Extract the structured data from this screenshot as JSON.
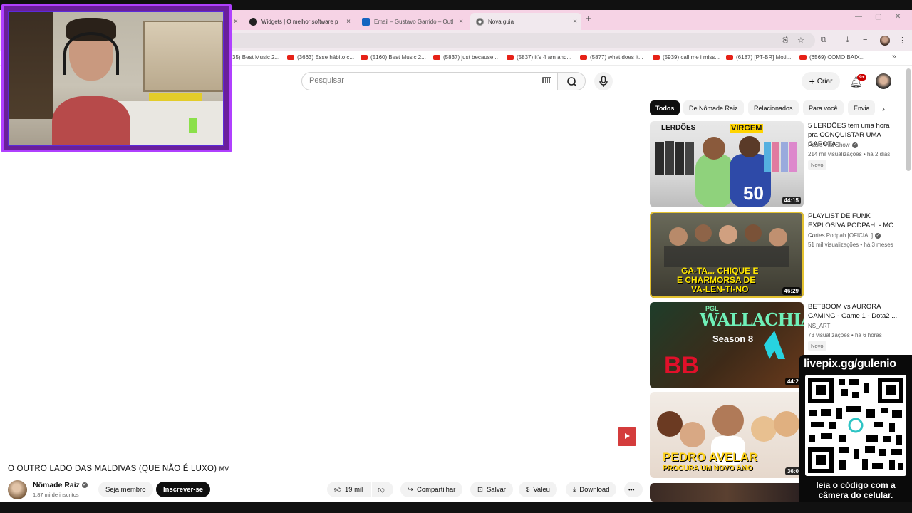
{
  "browser": {
    "tabs": [
      {
        "label": "Widgets | O melhor software p",
        "icon": "github-icon"
      },
      {
        "label": "Email – Gustavo Garrido – Outl",
        "icon": "outlook-icon"
      },
      {
        "label": "Nova guia",
        "icon": "chrome-icon"
      }
    ],
    "new_tab_symbol": "+",
    "bookmarks": [
      "35) Best Music 2...",
      "(3663) Esse hábito c...",
      "(5160) Best Music 2...",
      "(5837) just because...",
      "(5837) it's 4 am and...",
      "(5877) what does it...",
      "(5939) call me i miss...",
      "(6187) [PT-BR] Moti...",
      "(6569) COMO BAIX..."
    ],
    "bookmarks_more": "»"
  },
  "header": {
    "search_placeholder": "Pesquisar",
    "create_label": "Criar",
    "notification_badge": "9+"
  },
  "video": {
    "title": "O OUTRO LADO DAS MALDIVAS (QUE NÃO É LUXO)",
    "title_suffix": "MV",
    "channel_name": "Nômade Raiz",
    "subscribers": "1,87 mi de inscritos",
    "join_label": "Seja membro",
    "subscribe_label": "Inscrever-se",
    "likes": "19 mil",
    "share_label": "Compartilhar",
    "save_label": "Salvar",
    "thanks_label": "Valeu",
    "download_label": "Download",
    "more_symbol": "•••"
  },
  "chips": [
    "Todos",
    "De Nômade Raiz",
    "Relacionados",
    "Para você",
    "Envia"
  ],
  "recommendations": [
    {
      "title": "5 LERDÕES tem uma hora pra CONQUISTAR UMA GAROTA",
      "channel": "Paulo Vita Show",
      "meta": "214 mil visualizações • há 2 dias",
      "badge": "Novo",
      "duration": "44:15",
      "thumb_text_1": "LERDÕES",
      "thumb_text_2": "VIRGEM"
    },
    {
      "title": "PLAYLIST DE FUNK EXPLOSIVA PODPAH! - MC ...",
      "channel": "Cortes Podpah [OFICIAL]",
      "meta": "51 mil visualizações • há 3 meses",
      "duration": "46:29",
      "thumb_text_1": "GA-TA... CHIQUE E",
      "thumb_text_2": "E CHARMORSA DE",
      "thumb_text_3": "VA-LEN-TI-NO"
    },
    {
      "title": "BETBOOM vs AURORA GAMING - Game 1 - Dota2 ...",
      "channel": "NS_ART",
      "meta": "73 visualizações • há 6 horas",
      "badge": "Novo",
      "duration": "44:2",
      "thumb_text_1": "WALLACHIA",
      "thumb_text_2": "Season 8",
      "thumb_text_3": "PGL"
    },
    {
      "duration": "36:0",
      "thumb_text_1": "PEDRO AVELAR",
      "thumb_text_2": "PROCURA UM NOVO AMO"
    }
  ],
  "overlay": {
    "livepix": "livepix.gg/gulenio",
    "caption": "leia o código com a câmera do celular."
  }
}
